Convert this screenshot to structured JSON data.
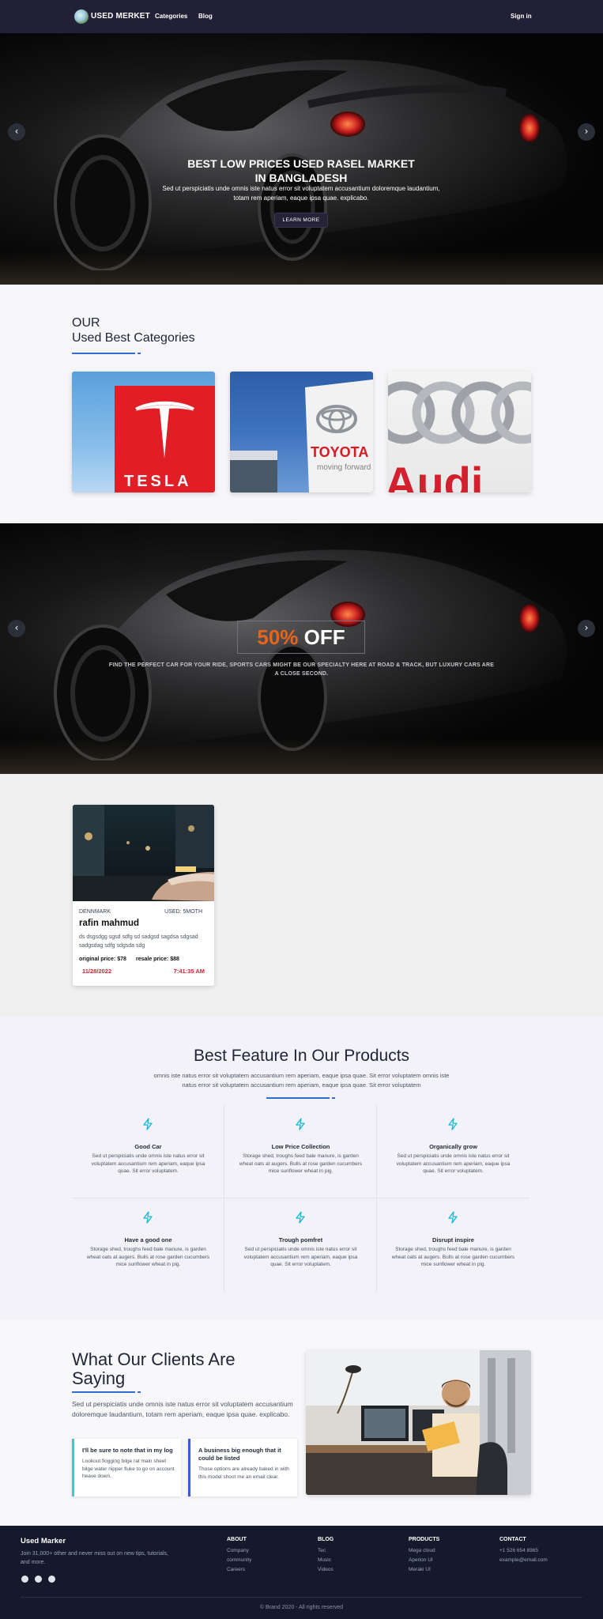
{
  "nav": {
    "brand": "USED MERKET",
    "links": [
      "Categories",
      "Blog"
    ],
    "signin": "Sign in"
  },
  "hero": {
    "title": "BEST LOW PRICES USED RASEL MARKET IN BANGLADESH",
    "subtitle": "Sed ut perspiciatis unde omnis iste natus error sit voluptatem accusantium doloremque laudantium, totam rem aperiam, eaque ipsa quae. explicabo.",
    "button": "LEARN MORE",
    "prev_icon": "chevron-left-icon",
    "next_icon": "chevron-right-icon"
  },
  "categories": {
    "heading_line1": "OUR",
    "heading_line2": "Used Best Categories",
    "items": [
      {
        "brand": "TESLA",
        "logo": "tesla-logo"
      },
      {
        "brand": "TOYOTA",
        "tagline": "moving forward",
        "logo": "toyota-logo"
      },
      {
        "brand": "Audi",
        "logo": "audi-logo"
      }
    ]
  },
  "offer": {
    "percent": "50%",
    "off": "OFF",
    "subtitle": "FIND THE PERFECT CAR FOR YOUR RIDE, SPORTS CARS MIGHT BE OUR SPECIALTY HERE AT ROAD & TRACK, BUT LUXURY CARS ARE A CLOSE SECOND."
  },
  "product": {
    "location": "DENNMARK",
    "used": "USED: 5MOTH",
    "name": "rafin mahmud",
    "description": "ds dsgsdgg sgsd sdfg sd sadgsd sagdsa sdgsad sadgsdag sdfg sdgsda sdg",
    "original_price": "original price: $78",
    "resale_price": "resale price: $88",
    "date": "11/28/2022",
    "time": "7:41:35 AM"
  },
  "features": {
    "title": "Best Feature In Our Products",
    "subtitle": "omnis iste natus error sit voluptatem accusantium rem aperiam, eaque ipsa quae. Sit error voluptatem omnis iste natus error sit voluptatem accusantium rem aperiam, eaque ipsa quae. Sit error voluptatem",
    "items": [
      {
        "name": "Good Car",
        "desc": "Sed ut perspiciatis unde omnis iste natus error sit voluptatem accusantium rem aperiam, eaque ipsa quae. Sit error voluptatem."
      },
      {
        "name": "Low Price Collection",
        "desc": "Storage shed, troughs feed bale manure, is garden wheat oats at augers. Bulls at rose garden cucumbers mice sunflower wheat in pig."
      },
      {
        "name": "Organically grow",
        "desc": "Sed ut perspiciatis unde omnis iste natus error sit voluptatem accusantium rem aperiam, eaque ipsa quae. Sit error voluptatem."
      },
      {
        "name": "Have a good one",
        "desc": "Storage shed, troughs feed bale manure, is garden wheat oats at augers. Bulls at rose garden cucumbers mice sunflower wheat in pig."
      },
      {
        "name": "Trough pomfret",
        "desc": "Sed ut perspiciatis unde omnis iste natus error sit voluptatem accusantium rem aperiam, eaque ipsa quae. Sit error voluptatem."
      },
      {
        "name": "Disrupt inspire",
        "desc": "Storage shed, troughs feed bale manure, is garden wheat oats at augers. Bulls at rose garden cucumbers mice sunflower wheat in pig."
      }
    ],
    "icon": "bolt-icon",
    "accent": "#14b8d6"
  },
  "testimonials": {
    "title": "What Our Clients Are Saying",
    "subtitle": "Sed ut perspiciatis unde omnis iste natus error sit voluptatem accusantium doloremque laudantium, totam rem aperiam, eaque ipsa quae. explicabo.",
    "cards": [
      {
        "quote": "I'll be sure to note that in my log",
        "text": "Lookout flogging bilge rat main sheet bilge water nipper fluke to go on account heave down.",
        "accent": "#2dd4bf"
      },
      {
        "quote": "A business big enough that it could be listed",
        "text": "Those options are already baked in with this model shoot me an email clear.",
        "accent": "#3b5bdb"
      }
    ]
  },
  "footer": {
    "brand": "Used Marker",
    "tagline": "Join 31,000+ other and never miss out on new tips, tutorials, and more.",
    "social_icons": [
      "dribbble-icon",
      "facebook-icon",
      "github-icon"
    ],
    "columns": [
      {
        "title": "ABOUT",
        "links": [
          "Company",
          "community",
          "Careers"
        ]
      },
      {
        "title": "BLOG",
        "links": [
          "Tec",
          "Music",
          "Videos"
        ]
      },
      {
        "title": "PRODUCTS",
        "links": [
          "Mega cloud",
          "Aperion UI",
          "Meraki UI"
        ]
      },
      {
        "title": "CONTACT",
        "links": [
          "+1 526 654 8965",
          "example@email.com"
        ]
      }
    ],
    "copyright": "© Brand 2020 - All rights reserved"
  },
  "colors": {
    "nav_bg": "#222037",
    "accent_blue": "#2f6cd3",
    "offer_orange": "#e8641b",
    "date_red": "#d6202f",
    "footer_bg": "#141a2b"
  }
}
